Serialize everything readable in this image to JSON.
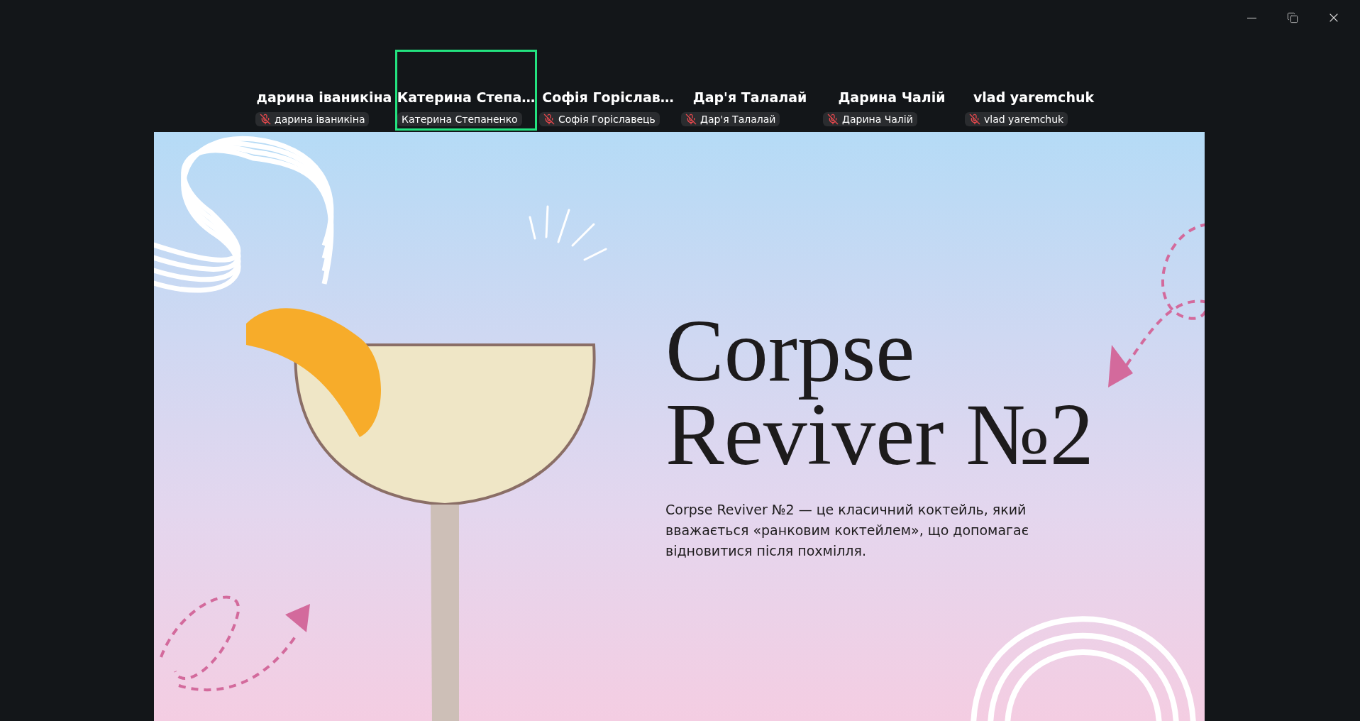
{
  "participants": [
    {
      "name": "дарина іваникіна",
      "label": "дарина іваникіна",
      "muted": true,
      "selected": false
    },
    {
      "name": "Катерина Степа…",
      "label": "Катерина Степаненко",
      "muted": false,
      "selected": true
    },
    {
      "name": "Софія Горіслав…",
      "label": "Софія Горіславець",
      "muted": true,
      "selected": false
    },
    {
      "name": "Дар'я Талалай",
      "label": "Дар'я Талалай",
      "muted": true,
      "selected": false
    },
    {
      "name": "Дарина Чалій",
      "label": "Дарина Чалій",
      "muted": true,
      "selected": false
    },
    {
      "name": "vlad yaremchuk",
      "label": "vlad yaremchuk",
      "muted": true,
      "selected": false
    }
  ],
  "slide": {
    "title": "Corpse Reviver №2",
    "body": "Corpse Reviver №2 — це класичний коктейль, який вважається «ранковим коктейлем», що допомагає відновитися після похмілля."
  }
}
